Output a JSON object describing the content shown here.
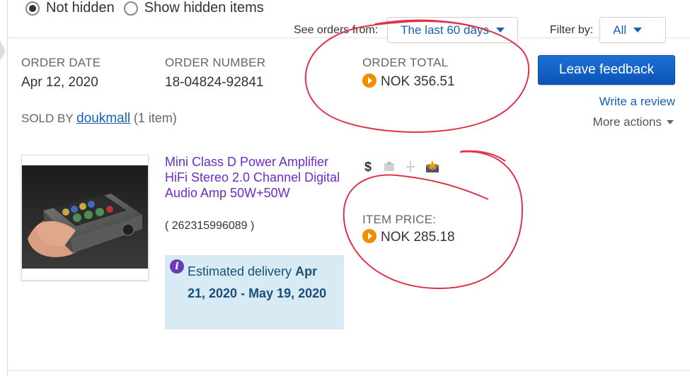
{
  "visibility": {
    "options": [
      {
        "label": "Not hidden",
        "checked": true
      },
      {
        "label": "Show hidden items",
        "checked": false
      }
    ]
  },
  "filters": {
    "see_orders_label": "See orders from:",
    "see_orders_value": "The last 60 days",
    "filter_by_label": "Filter by:",
    "filter_by_value": "All"
  },
  "order": {
    "date_label": "ORDER DATE",
    "date_value": "Apr 12, 2020",
    "number_label": "ORDER NUMBER",
    "number_value": "18-04824-92841",
    "total_label": "ORDER TOTAL",
    "total_value": "NOK 356.51",
    "sold_by_label": "SOLD BY",
    "seller": "doukmall",
    "item_count": "(1 item)"
  },
  "actions": {
    "leave_feedback": "Leave feedback",
    "write_review": "Write a review",
    "more_actions": "More actions"
  },
  "item": {
    "title": "Mini Class D Power Amplifier HiFi Stereo 2.0 Channel Digital Audio Amp 50W+50W",
    "id": "( 262315996089 )",
    "price_label": "ITEM PRICE:",
    "price_value": "NOK 285.18",
    "status_icons": [
      "dollar-icon",
      "shipped-box-icon",
      "feedback-received-icon",
      "feedback-left-icon"
    ],
    "delivery_prefix": "Estimated delivery",
    "delivery_range": "Apr 21, 2020 - May 19, 2020"
  },
  "colors": {
    "accent": "#1a5fb4",
    "button": "#0a55b5",
    "item_link": "#6b2cc9",
    "delivery_bg": "#d8ebf5",
    "currency_coin": "#f28c00",
    "annotation": "#e0334a"
  }
}
